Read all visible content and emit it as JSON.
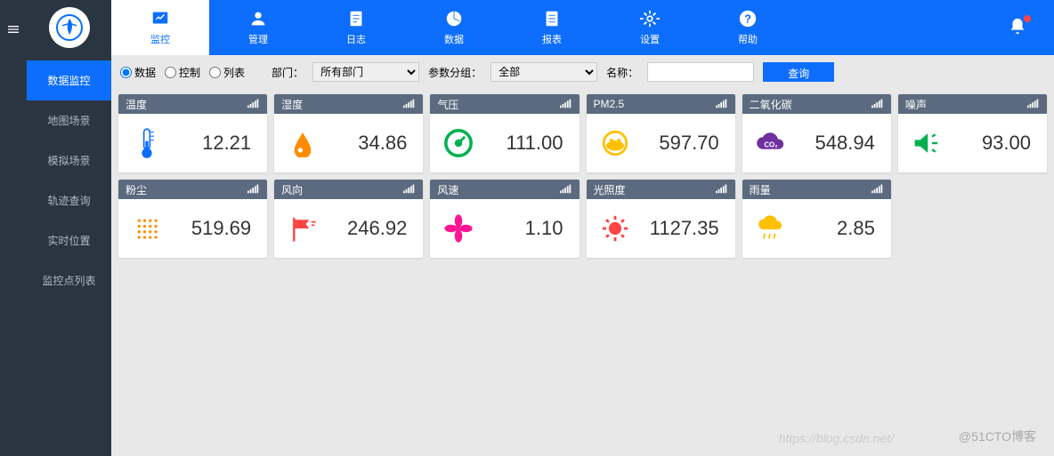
{
  "header": {
    "tabs": [
      {
        "label": "监控",
        "icon": "chart"
      },
      {
        "label": "管理",
        "icon": "user"
      },
      {
        "label": "日志",
        "icon": "edit"
      },
      {
        "label": "数据",
        "icon": "pie"
      },
      {
        "label": "报表",
        "icon": "doc"
      },
      {
        "label": "设置",
        "icon": "gear"
      },
      {
        "label": "帮助",
        "icon": "help"
      }
    ]
  },
  "sidebar": {
    "items": [
      {
        "label": "数据监控"
      },
      {
        "label": "地图场景"
      },
      {
        "label": "模拟场景"
      },
      {
        "label": "轨迹查询"
      },
      {
        "label": "实时位置"
      },
      {
        "label": "监控点列表"
      }
    ]
  },
  "filters": {
    "radio1": "数据",
    "radio2": "控制",
    "radio3": "列表",
    "dept_label": "部门：",
    "dept_value": "所有部门",
    "group_label": "参数分组：",
    "group_value": "全部",
    "name_label": "名称：",
    "name_value": "",
    "query": "查询"
  },
  "cards": [
    {
      "title": "温度",
      "value": "12.21",
      "color": "#0d6efd"
    },
    {
      "title": "湿度",
      "value": "34.86",
      "color": "#ff8c00"
    },
    {
      "title": "气压",
      "value": "111.00",
      "color": "#00b050"
    },
    {
      "title": "PM2.5",
      "value": "597.70",
      "color": "#ffc000"
    },
    {
      "title": "二氧化碳",
      "value": "548.94",
      "color": "#7030a0"
    },
    {
      "title": "噪声",
      "value": "93.00",
      "color": "#00b050"
    },
    {
      "title": "粉尘",
      "value": "519.69",
      "color": "#ff8c00"
    },
    {
      "title": "风向",
      "value": "246.92",
      "color": "#ff4444"
    },
    {
      "title": "风速",
      "value": "1.10",
      "color": "#ff1493"
    },
    {
      "title": "光照度",
      "value": "1127.35",
      "color": "#ff4444"
    },
    {
      "title": "雨量",
      "value": "2.85",
      "color": "#ffc000"
    }
  ],
  "watermark1": "https://blog.csdn.net/",
  "watermark2": "@51CTO博客"
}
